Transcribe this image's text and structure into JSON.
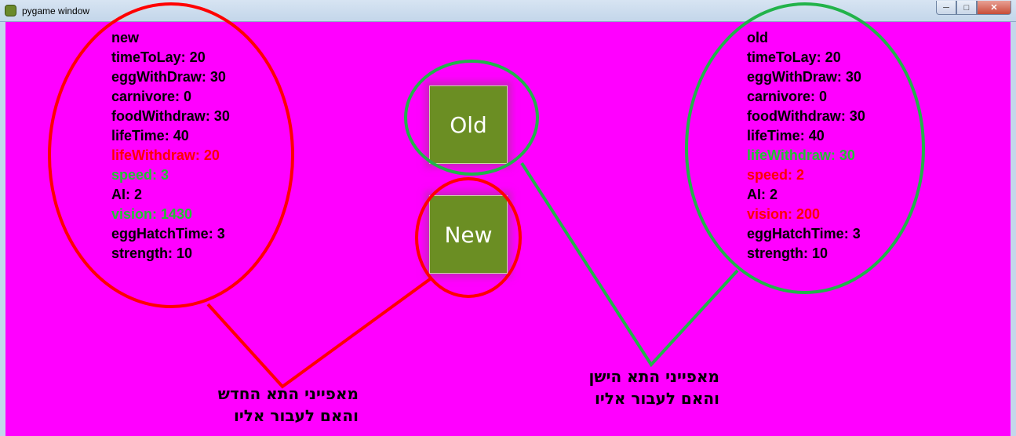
{
  "window": {
    "title": "pygame window",
    "minimize": "─",
    "maximize": "□",
    "close": "✕"
  },
  "new_stats": [
    {
      "text": "new",
      "status": "normal"
    },
    {
      "text": "timeToLay: 20",
      "status": "normal"
    },
    {
      "text": "eggWithDraw: 30",
      "status": "normal"
    },
    {
      "text": "carnivore: 0",
      "status": "normal"
    },
    {
      "text": "foodWithdraw: 30",
      "status": "normal"
    },
    {
      "text": "lifeTime: 40",
      "status": "normal"
    },
    {
      "text": "lifeWithdraw: 20",
      "status": "worse"
    },
    {
      "text": "speed: 3",
      "status": "better"
    },
    {
      "text": "AI: 2",
      "status": "normal"
    },
    {
      "text": "vision: 1430",
      "status": "better"
    },
    {
      "text": "eggHatchTime: 3",
      "status": "normal"
    },
    {
      "text": "strength: 10",
      "status": "normal"
    }
  ],
  "old_stats": [
    {
      "text": "old",
      "status": "normal"
    },
    {
      "text": "timeToLay: 20",
      "status": "normal"
    },
    {
      "text": "eggWithDraw: 30",
      "status": "normal"
    },
    {
      "text": "carnivore: 0",
      "status": "normal"
    },
    {
      "text": "foodWithdraw: 30",
      "status": "normal"
    },
    {
      "text": "lifeTime: 40",
      "status": "normal"
    },
    {
      "text": "lifeWithdraw: 30",
      "status": "better"
    },
    {
      "text": "speed: 2",
      "status": "worse"
    },
    {
      "text": "AI: 2",
      "status": "normal"
    },
    {
      "text": "vision: 200",
      "status": "worse"
    },
    {
      "text": "eggHatchTime: 3",
      "status": "normal"
    },
    {
      "text": "strength: 10",
      "status": "normal"
    }
  ],
  "buttons": {
    "old": "Old",
    "new": "New"
  },
  "annotations": {
    "new_line1": "מאפייני התא החדש",
    "new_line2": "והאם לעבור אליו",
    "old_line1": "מאפייני התא הישן",
    "old_line2": "והאם לעבור אליו"
  },
  "colors": {
    "background": "#ff00ff",
    "button": "#6b8e23",
    "better": "#22c233",
    "worse": "#ff0000",
    "annotation_red": "#ff0000",
    "annotation_green": "#22b34a"
  }
}
